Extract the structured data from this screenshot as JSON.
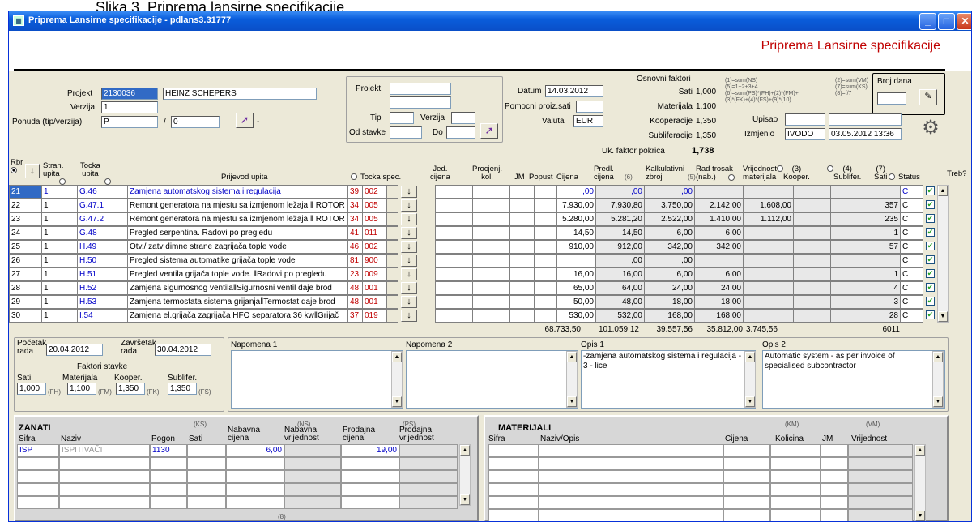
{
  "caption": "Slika 3. Priprema lansirne specifikacije",
  "window": {
    "title": "Priprema Lansirne specifikacije - pdlans3.31777",
    "icon": "app-icon",
    "minimize": "_",
    "maximize": "□",
    "close": "✕"
  },
  "header": {
    "title": "Priprema Lansirne specifikacije"
  },
  "form": {
    "projekt_label": "Projekt",
    "projekt_code": "2130036",
    "projekt_name": "HEINZ SCHEPERS",
    "verzija_label": "Verzija",
    "verzija_value": "1",
    "ponuda_label": "Ponuda (tip/verzija)",
    "ponuda_tip": "P",
    "ponuda_sep": "/",
    "ponuda_ver": "0",
    "dash": "-",
    "filter": {
      "projekt_label": "Projekt",
      "tip_label": "Tip",
      "verzija_label": "Verzija",
      "od_label": "Od stavke",
      "do_label": "Do"
    },
    "datum_label": "Datum",
    "datum_value": "14.03.2012",
    "pomocni_label": "Pomocni proiz.sati",
    "valuta_label": "Valuta",
    "valuta_value": "EUR",
    "osnovni_label": "Osnovni faktori",
    "faktori": [
      {
        "label": "Sati",
        "value": "1,000"
      },
      {
        "label": "Materijala",
        "value": "1,100"
      },
      {
        "label": "Kooperacije",
        "value": "1,350"
      },
      {
        "label": "Subliferacije",
        "value": "1,350"
      }
    ],
    "uk_label": "Uk. faktor pokrica",
    "uk_value": "1,738",
    "formula1": "(1)=sum(NS)\n(5)=1+2+3+4\n(6)=sum(PS)*(FH)+(2)*(FM)+\n(3)*(FK)+(4)*(FS)+(9)*(10)",
    "formula2": "(2)=sum(VM)\n(7)=sum(KS)\n(8)=f/7",
    "broj_dana_label": "Broj dana",
    "upisao_label": "Upisao",
    "izmjenio_label": "Izmjenio",
    "izmjenio_user": "IVODO",
    "izmjenio_date": "03.05.2012 13:36"
  },
  "table": {
    "headers": {
      "rbr": "Rbr",
      "stran": "Stran.\nupita",
      "tocka_upita": "Tocka\nupita",
      "prijevod": "Prijevod upita",
      "tocka_spec": "Tocka spec.",
      "jed": "Jed.\ncijena",
      "procj": "Procjenj.\nkol.",
      "jm": "JM",
      "popust": "Popust",
      "cijena": "Cijena",
      "predl": "Predl.\ncijena",
      "predl_n": "(6)",
      "kalk": "Kalkulativni\nzbroj",
      "kalk_n": "(5)",
      "rad": "Rad trosak\n(nab.)",
      "vrij": "Vrijednost\nmaterijala",
      "vrij_n": "(2)",
      "koop": "(3)\nKooper.",
      "subl": "(4)\nSublifer.",
      "sati": "(7)\nSati",
      "status": "Status",
      "treb": "Treb?"
    },
    "rows": [
      {
        "rbr": "21",
        "stran": "1",
        "tocka": "G.46",
        "prijevod": "Zamjena automatskog sistema i regulacija",
        "ts1": "39",
        "ts2": "002",
        "cijena": ",00",
        "predl": ",00",
        "kalk": ",00",
        "rad": "",
        "vrij": "",
        "koop": "",
        "subl": "",
        "sati": "",
        "status": "C",
        "treb": "✔",
        "sel": true
      },
      {
        "rbr": "22",
        "stran": "1",
        "tocka": "G.47.1",
        "prijevod": "Remont generatora na mjestu sa izmjenom ležaja.‖ ROTOR",
        "ts1": "34",
        "ts2": "005",
        "cijena": "7.930,00",
        "predl": "7.930,80",
        "kalk": "3.750,00",
        "rad": "2.142,00",
        "vrij": "1.608,00",
        "koop": "",
        "subl": "",
        "sati": "357",
        "status": "C",
        "treb": "✔"
      },
      {
        "rbr": "23",
        "stran": "1",
        "tocka": "G.47.2",
        "prijevod": "Remont generatora na mjestu sa izmjenom ležaja.‖ ROTOR",
        "ts1": "34",
        "ts2": "005",
        "cijena": "5.280,00",
        "predl": "5.281,20",
        "kalk": "2.522,00",
        "rad": "1.410,00",
        "vrij": "1.112,00",
        "koop": "",
        "subl": "",
        "sati": "235",
        "status": "C",
        "treb": "✔"
      },
      {
        "rbr": "24",
        "stran": "1",
        "tocka": "G.48",
        "prijevod": "Pregled serpentina. Radovi po pregledu",
        "ts1": "41",
        "ts2": "011",
        "cijena": "14,50",
        "predl": "14,50",
        "kalk": "6,00",
        "rad": "6,00",
        "vrij": "",
        "koop": "",
        "subl": "",
        "sati": "1",
        "status": "C",
        "treb": "✔"
      },
      {
        "rbr": "25",
        "stran": "1",
        "tocka": "H.49",
        "prijevod": "Otv./ zatv dimne strane zagrijača tople vode",
        "ts1": "46",
        "ts2": "002",
        "cijena": "910,00",
        "predl": "912,00",
        "kalk": "342,00",
        "rad": "342,00",
        "vrij": "",
        "koop": "",
        "subl": "",
        "sati": "57",
        "status": "C",
        "treb": "✔"
      },
      {
        "rbr": "26",
        "stran": "1",
        "tocka": "H.50",
        "prijevod": "Pregled sistema automatike grijača tople vode",
        "ts1": "81",
        "ts2": "900",
        "cijena": "",
        "predl": ",00",
        "kalk": ",00",
        "rad": "",
        "vrij": "",
        "koop": "",
        "subl": "",
        "sati": "",
        "status": "C",
        "treb": "✔"
      },
      {
        "rbr": "27",
        "stran": "1",
        "tocka": "H.51",
        "prijevod": "Pregled ventila grijača tople vode. ‖Radovi po pregledu",
        "ts1": "23",
        "ts2": "009",
        "cijena": "16,00",
        "predl": "16,00",
        "kalk": "6,00",
        "rad": "6,00",
        "vrij": "",
        "koop": "",
        "subl": "",
        "sati": "1",
        "status": "C",
        "treb": "✔"
      },
      {
        "rbr": "28",
        "stran": "1",
        "tocka": "H.52",
        "prijevod": "Zamjena sigurnosnog ventila‖Sigurnosni ventil daje brod",
        "ts1": "48",
        "ts2": "001",
        "cijena": "65,00",
        "predl": "64,00",
        "kalk": "24,00",
        "rad": "24,00",
        "vrij": "",
        "koop": "",
        "subl": "",
        "sati": "4",
        "status": "C",
        "treb": "✔"
      },
      {
        "rbr": "29",
        "stran": "1",
        "tocka": "H.53",
        "prijevod": "Zamjena termostata sistema grijanja‖Termostat daje brod",
        "ts1": "48",
        "ts2": "001",
        "cijena": "50,00",
        "predl": "48,00",
        "kalk": "18,00",
        "rad": "18,00",
        "vrij": "",
        "koop": "",
        "subl": "",
        "sati": "3",
        "status": "C",
        "treb": "✔"
      },
      {
        "rbr": "30",
        "stran": "1",
        "tocka": "I.54",
        "prijevod": "Zamjena el.grijača zagrijača HFO separatora,36 kw‖Grijač",
        "ts1": "37",
        "ts2": "019",
        "cijena": "530,00",
        "predl": "532,00",
        "kalk": "168,00",
        "rad": "168,00",
        "vrij": "",
        "koop": "",
        "subl": "",
        "sati": "28",
        "status": "C",
        "treb": "✔"
      }
    ],
    "totals": {
      "cijena": "68.733,50",
      "predl": "101.059,12",
      "kalk": "39.557,56",
      "rad": "35.812,00",
      "vrij": "3.745,56",
      "sati": "6011"
    }
  },
  "bottom": {
    "pocetak_label": "Početak\nrada",
    "pocetak_value": "20.04.2012",
    "zavrsetak_label": "Završetak\nrada",
    "zavrsetak_value": "30.04.2012",
    "faktori_label": "Faktori stavke",
    "fs": [
      {
        "label": "Sati",
        "value": "1,000",
        "code": "(FH)"
      },
      {
        "label": "Materijala",
        "value": "1,100",
        "code": "(FM)"
      },
      {
        "label": "Kooper.",
        "value": "1,350",
        "code": "(FK)"
      },
      {
        "label": "Sublifer.",
        "value": "1,350",
        "code": "(FS)"
      }
    ],
    "napomena1": "Napomena 1",
    "napomena2": "Napomena 2",
    "opis1_label": "Opis 1",
    "opis1_text": "-zamjena automatskog sistema i regulacija - 3 - lice",
    "opis2_label": "Opis 2",
    "opis2_text": "Automatic system - as per invoice of specialised subcontractor"
  },
  "zanati": {
    "title": "ZANATI",
    "ks": "(KS)",
    "ns": "(NS)",
    "ps": "(PS)",
    "n8": "(8)",
    "headers": {
      "sifra": "Sifra",
      "naziv": "Naziv",
      "pogon": "Pogon",
      "sati": "Sati",
      "nab": "Nabavna\ncijena",
      "nabv": "Nabavna\nvrijednost",
      "prod": "Prodajna\ncijena",
      "prodv": "Prodajna\nvrijednost"
    },
    "row": {
      "sifra": "ISP",
      "naziv": "ISPITIVAČI",
      "pogon": "1130",
      "sati": "",
      "nab": "6,00",
      "nabv": "",
      "prod": "19,00",
      "prodv": ""
    }
  },
  "materijali": {
    "title": "MATERIJALI",
    "km": "(KM)",
    "vm": "(VM)",
    "headers": {
      "sifra": "Sifra",
      "naziv": "Naziv/Opis",
      "cijena": "Cijena",
      "kolicina": "Kolicina",
      "jm": "JM",
      "vrij": "Vrijednost"
    }
  }
}
